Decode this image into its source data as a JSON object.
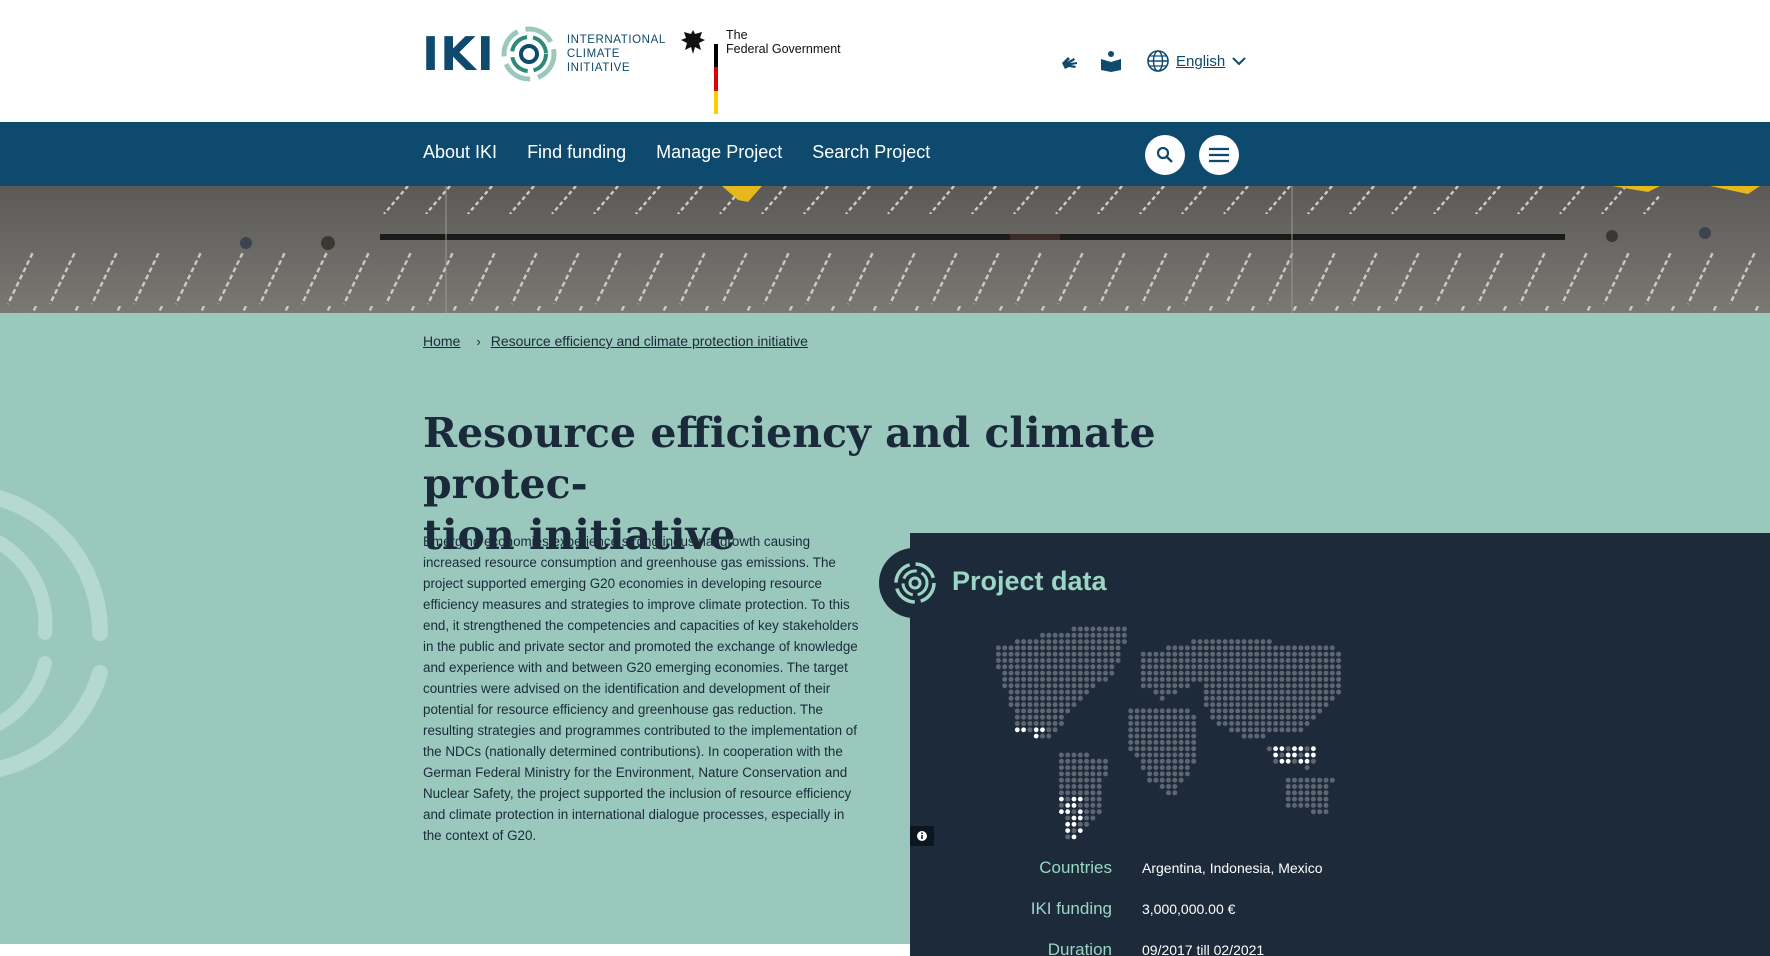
{
  "header": {
    "iki_letters": "IKI",
    "iki_tagline": [
      "INTERNATIONAL",
      "CLIMATE",
      "INITIATIVE"
    ],
    "federal_line1": "The",
    "federal_line2": "Federal Government",
    "sign_language_icon": "sign-language-icon",
    "easy_language_icon": "easy-language-icon",
    "language_label": "English"
  },
  "nav": {
    "items": [
      {
        "label": "About IKI"
      },
      {
        "label": "Find funding"
      },
      {
        "label": "Manage Project"
      },
      {
        "label": "Search Project"
      }
    ]
  },
  "breadcrumb": {
    "home": "Home",
    "current": "Resource efficiency and climate protection initiative"
  },
  "page": {
    "title_line1": "Resource efficiency and climate protec-",
    "title_line2": "tion initiative",
    "description": "Emerging economies experience strong industrial growth causing increased resource consumption and greenhouse gas emissions. The project supported emerging G20 economies in developing resource efficiency measures and strategies to improve climate protection. To this end, it strengthened the competencies and capacities of key stakeholders in the public and private sector and promoted the exchange of knowledge and experience with and between G20 emerging economies. The target countries were advised on the identification and development of their potential for resource efficiency and greenhouse gas reduction. The resulting strategies and programmes contributed to the implementation of the NDCs (nationally determined contributions). In cooperation with the German Federal Ministry for the Environment, Nature Conservation and Nuclear Safety, the project supported the inclusion of resource efficiency and climate protection in international dialogue processes, especially in the context of G20."
  },
  "project_data": {
    "title": "Project data",
    "rows": [
      {
        "key": "Countries",
        "value": "Argentina, Indonesia, Mexico"
      },
      {
        "key": "IKI funding",
        "value": "3,000,000.00 €"
      },
      {
        "key": "Duration",
        "value": "09/2017 till 02/2021"
      }
    ]
  },
  "colors": {
    "brand_blue": "#0e4a6e",
    "teal_bg": "#9bc8bd",
    "panel_bg": "#1d2a3a",
    "accent_mint": "#9bd6c4"
  }
}
